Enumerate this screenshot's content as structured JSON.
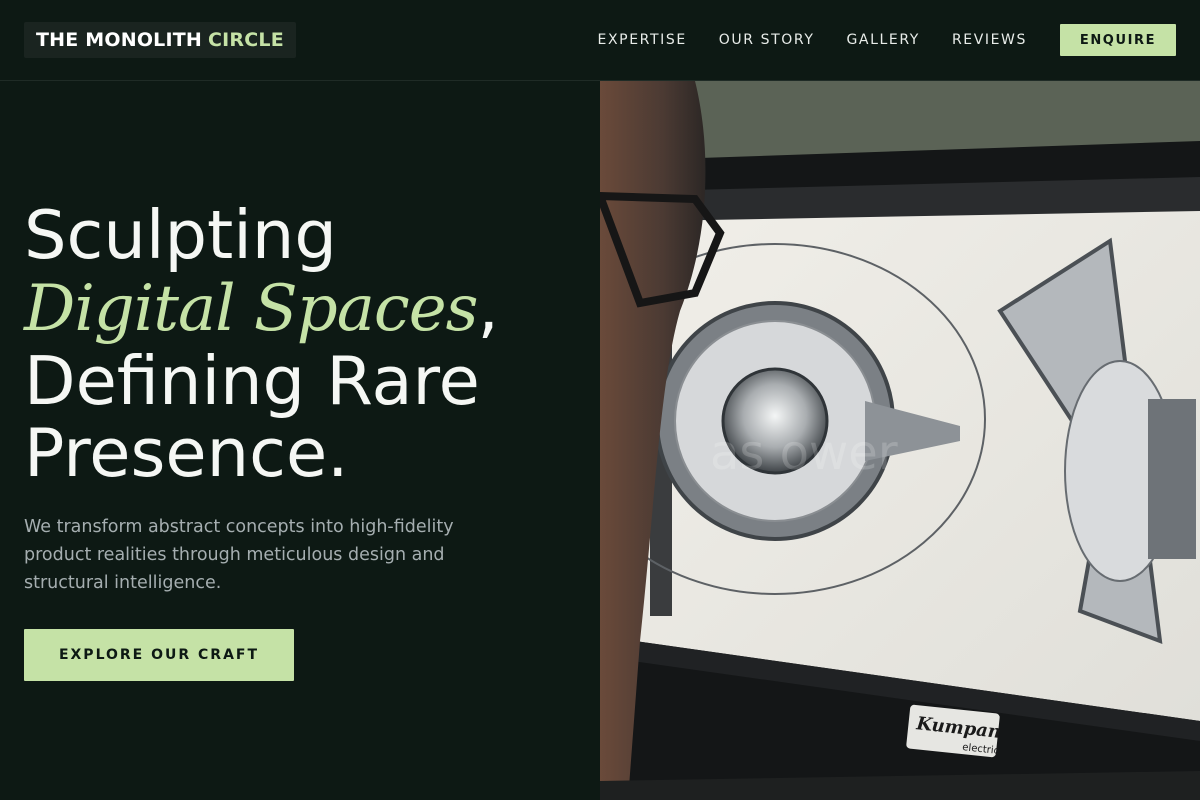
{
  "header": {
    "logo_part1": "THE MONOLITH",
    "logo_part2": "CIRCLE",
    "nav": [
      "EXPERTISE",
      "OUR STORY",
      "GALLERY",
      "REVIEWS"
    ],
    "cta_label": "ENQUIRE"
  },
  "hero": {
    "headline_line1": "Sculpting",
    "headline_italic": "Digital Spaces",
    "headline_comma": ",",
    "headline_line3": "Defining Rare",
    "headline_line4": "Presence.",
    "description": "We transform abstract concepts into high-fidelity product realities through meticulous design and structural intelligence.",
    "cta_label": "EXPLORE OUR CRAFT"
  },
  "image": {
    "monitor_brand": "Kumpan",
    "monitor_brand_sub": "electric"
  },
  "colors": {
    "background": "#0d1914",
    "accent": "#c5e2a6",
    "text": "#f5f7f4",
    "muted": "#a5aeb0"
  }
}
